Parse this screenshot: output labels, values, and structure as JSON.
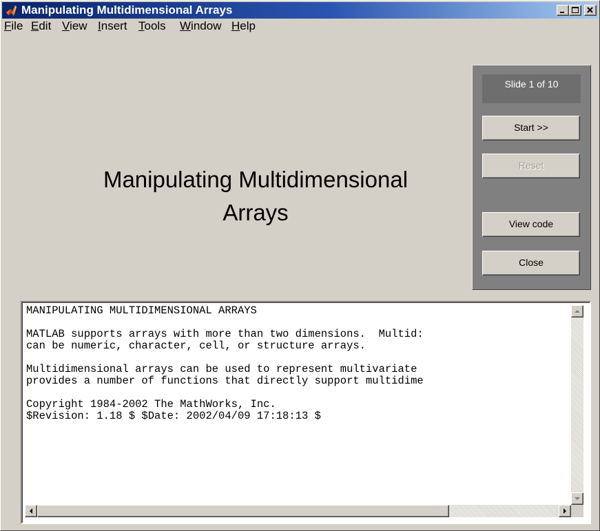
{
  "window": {
    "title": "Manipulating Multidimensional Arrays"
  },
  "menu": [
    {
      "underline": "F",
      "rest": "ile"
    },
    {
      "underline": "E",
      "rest": "dit"
    },
    {
      "underline": "V",
      "rest": "iew"
    },
    {
      "underline": "I",
      "rest": "nsert"
    },
    {
      "underline": "T",
      "rest": "ools"
    },
    {
      "underline": "W",
      "rest": "indow"
    },
    {
      "underline": "H",
      "rest": "elp"
    }
  ],
  "main": {
    "title_line1": "Manipulating Multidimensional",
    "title_line2": "Arrays"
  },
  "panel": {
    "slide_label": "Slide 1 of 10",
    "start_label": "Start >>",
    "reset_label": "Reset",
    "view_code_label": "View code",
    "close_label": "Close"
  },
  "textbox": {
    "lines": [
      "MANIPULATING MULTIDIMENSIONAL ARRAYS",
      "",
      "MATLAB supports arrays with more than two dimensions.  Multid:",
      "can be numeric, character, cell, or structure arrays.",
      "",
      "Multidimensional arrays can be used to represent multivariate",
      "provides a number of functions that directly support multidime",
      "",
      "Copyright 1984-2002 The MathWorks, Inc.",
      "$Revision: 1.18 $ $Date: 2002/04/09 17:18:13 $"
    ]
  },
  "colors": {
    "titlebar_start": "#0a246a",
    "titlebar_end": "#a6caf0",
    "face": "#d4d0c8",
    "panel": "#808080"
  },
  "icons": {
    "app": "matlab-logo-icon",
    "minimize": "minimize-icon",
    "maximize": "maximize-icon",
    "close": "close-icon"
  }
}
